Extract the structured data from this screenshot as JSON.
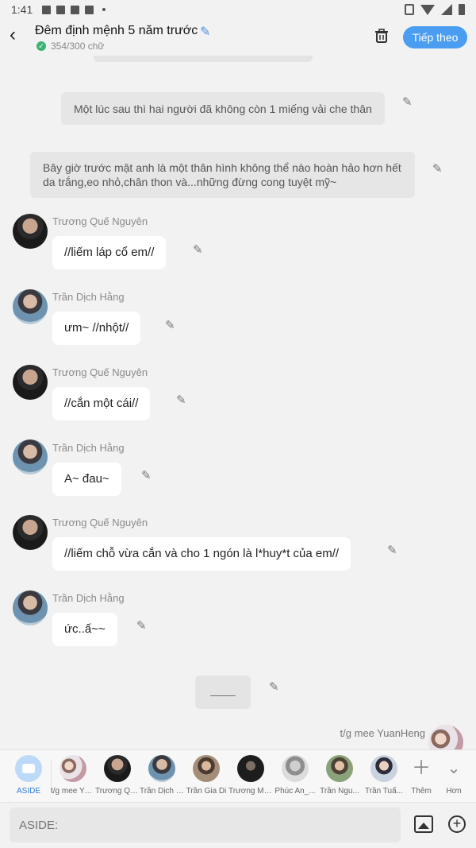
{
  "status_bar": {
    "time": "1:41"
  },
  "header": {
    "title": "Đêm định mệnh 5 năm trước",
    "word_count": "354/300 chữ",
    "next_label": "Tiếp theo",
    "accent_color": "#4a9df0"
  },
  "chat": {
    "narrations": [
      {
        "text": "Một lúc sau thì hai người đã không còn 1 miếng vải che thân"
      },
      {
        "text": "Bây giờ trước mặt anh là một thân hình không thể nào hoàn hảo hơn hết da trắng,eo nhỏ,chân thon và...những đừng cong tuyệt mỹ~"
      }
    ],
    "messages": [
      {
        "speaker": "Trương Quế Nguyên",
        "text": "//liếm láp cổ em//"
      },
      {
        "speaker": "Trần Dịch Hằng",
        "text": "ưm~ //nhột//"
      },
      {
        "speaker": "Trương Quế Nguyên",
        "text": "//cắn một cái//"
      },
      {
        "speaker": "Trần Dịch Hằng",
        "text": "A~ đau~"
      },
      {
        "speaker": "Trương Quế Nguyên",
        "text": "//liếm chỗ vừa cắn và cho 1 ngón là l*huy*t của em//"
      },
      {
        "speaker": "Trần Dịch Hằng",
        "text": "ức..ấ~~"
      }
    ],
    "divider_text": "____",
    "author_note": "t/g mee YuanHeng"
  },
  "characters": [
    {
      "label": "ASIDE"
    },
    {
      "label": "t/g mee YuanHeng"
    },
    {
      "label": "Trương Quế Nguyên"
    },
    {
      "label": "Trần Dịch Hằng"
    },
    {
      "label": "Trần Gia Di"
    },
    {
      "label": "Trương Mỹ..."
    },
    {
      "label": "Phúc An_..."
    },
    {
      "label": "Trần Ngu..."
    },
    {
      "label": "Trần Tuấ..."
    },
    {
      "label": "Thêm"
    },
    {
      "label": "Hơn"
    }
  ],
  "input": {
    "placeholder": "ASIDE:"
  }
}
